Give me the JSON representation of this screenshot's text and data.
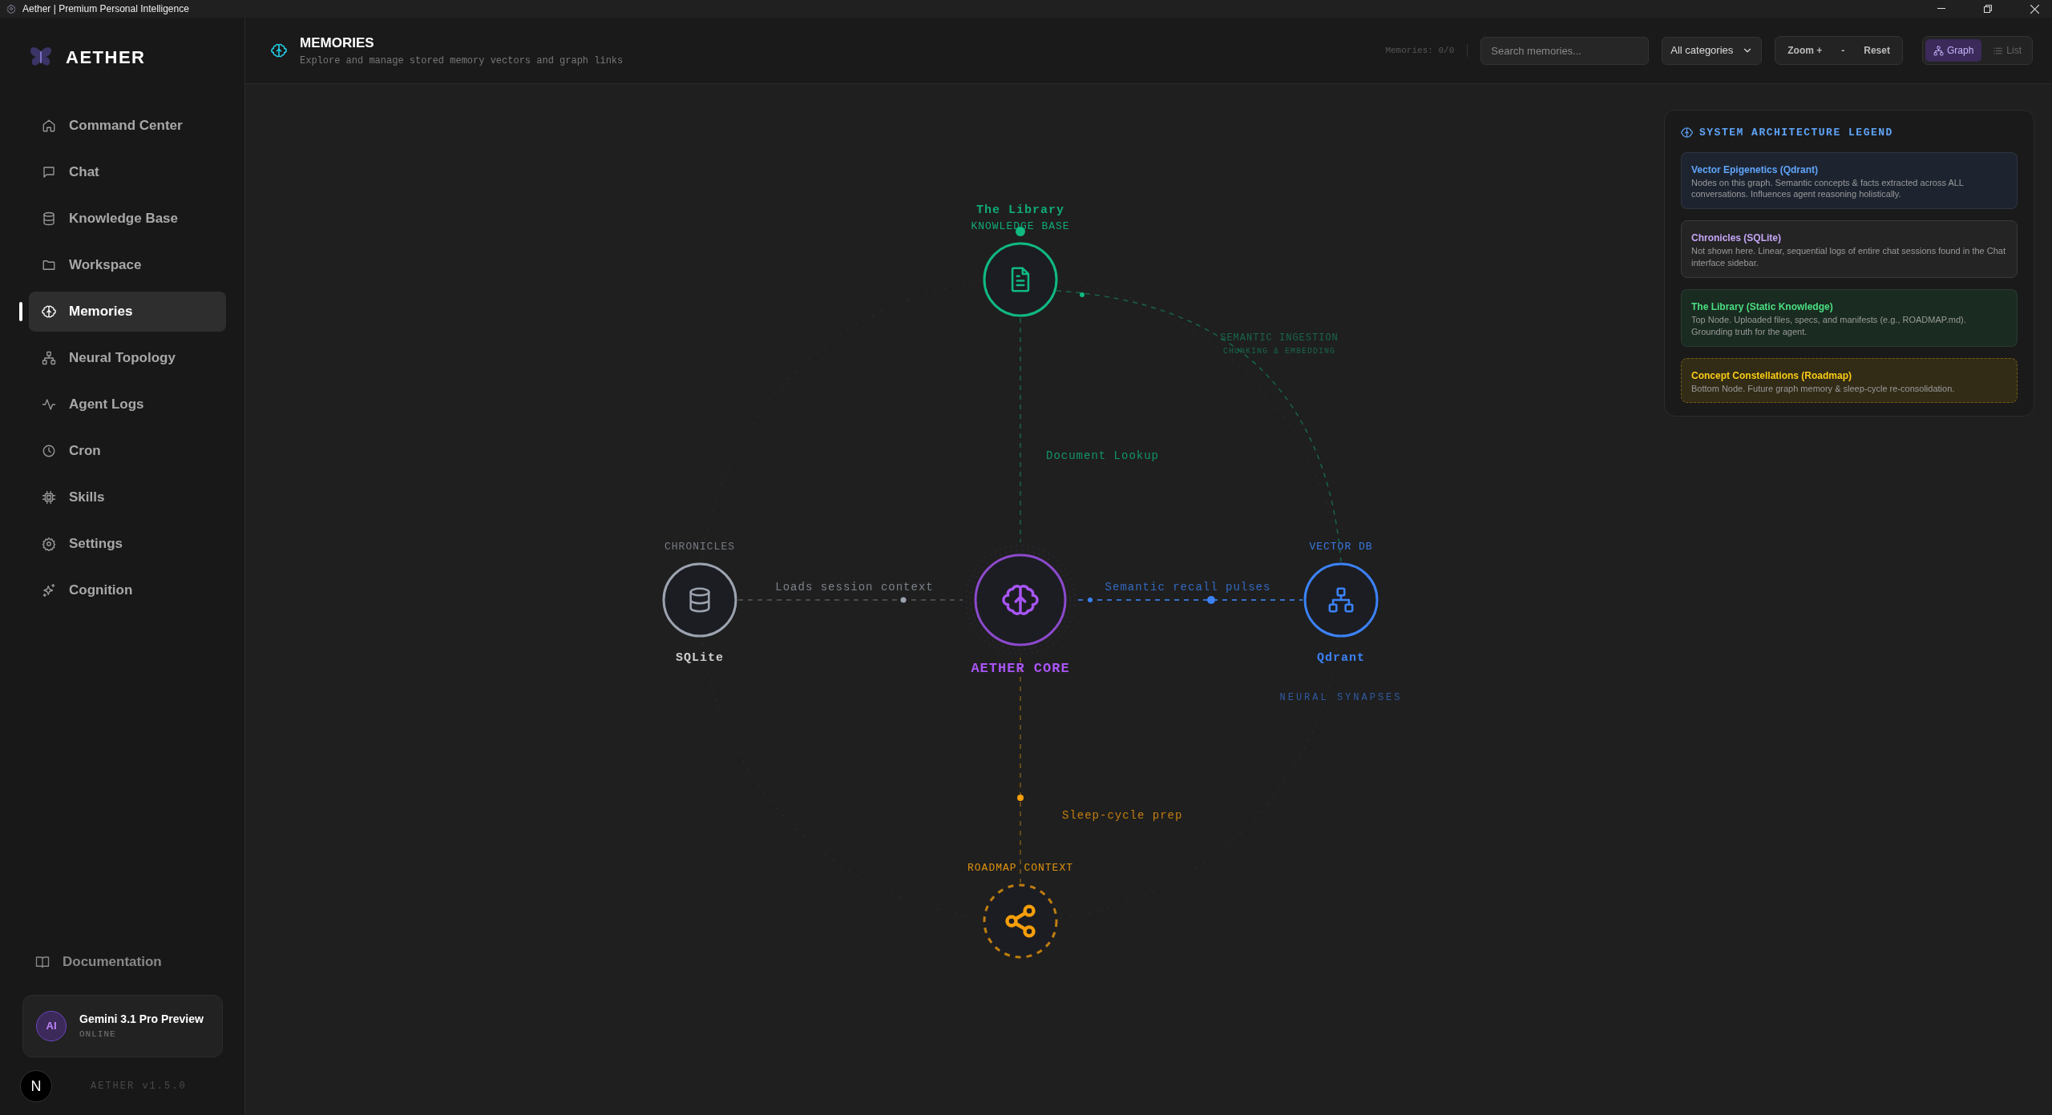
{
  "window": {
    "title": "Aether | Premium Personal Intelligence"
  },
  "sidebar": {
    "brand": "AETHER",
    "items": [
      {
        "label": "Command Center",
        "selected": false
      },
      {
        "label": "Chat",
        "selected": false
      },
      {
        "label": "Knowledge Base",
        "selected": false
      },
      {
        "label": "Workspace",
        "selected": false
      },
      {
        "label": "Memories",
        "selected": true
      },
      {
        "label": "Neural Topology",
        "selected": false
      },
      {
        "label": "Agent Logs",
        "selected": false
      },
      {
        "label": "Cron",
        "selected": false
      },
      {
        "label": "Skills",
        "selected": false
      },
      {
        "label": "Settings",
        "selected": false
      },
      {
        "label": "Cognition",
        "selected": false
      }
    ],
    "footer_link": "Documentation",
    "model": {
      "avatar": "AI",
      "name": "Gemini 3.1 Pro Preview",
      "status": "ONLINE"
    },
    "user_initial": "N",
    "version": "AETHER v1.5.0"
  },
  "header": {
    "title": "MEMORIES",
    "subtitle": "Explore and manage stored memory vectors and graph links",
    "count": "Memories: 0/0",
    "search": {
      "placeholder": "Search memories..."
    },
    "category": "All categories",
    "zoom_buttons": [
      "Zoom +",
      "-",
      "Reset"
    ],
    "views": [
      {
        "label": "Graph",
        "selected": true
      },
      {
        "label": "List",
        "selected": false
      }
    ]
  },
  "graph": {
    "nodes": [
      {
        "kind": "solid",
        "color": "#10b981",
        "above": [
          "The Library",
          "KNOWLEDGE BASE"
        ]
      },
      {
        "kind": "solid",
        "color": "#9ca3af",
        "above": [
          "CHRONICLES"
        ],
        "below": [
          "SQLite"
        ]
      },
      {
        "kind": "core",
        "color": "#a855f7",
        "below": [
          "AETHER CORE"
        ]
      },
      {
        "kind": "solid",
        "color": "#3b82f6",
        "above": [
          "VECTOR DB"
        ],
        "below": [
          "Qdrant",
          "NEURAL SYNAPSES"
        ]
      },
      {
        "kind": "dashed",
        "color": "#f59e0b",
        "above": [
          "ROADMAP CONTEXT"
        ]
      }
    ],
    "edges": [
      {
        "color": "#10b981",
        "labels": [
          "Document Lookup"
        ]
      },
      {
        "color": "#9ca3af",
        "labels": [
          "Loads session context"
        ]
      },
      {
        "color": "#3b82f6",
        "labels": [
          "Semantic recall pulses"
        ]
      },
      {
        "color": "#10b981",
        "labels": [
          "SEMANTIC INGESTION",
          "CHUNKING & EMBEDDING"
        ]
      },
      {
        "color": "#f59e0b",
        "labels": [
          "Sleep-cycle prep"
        ]
      }
    ]
  },
  "legend": {
    "title": "SYSTEM ARCHITECTURE LEGEND",
    "items": [
      {
        "kind": "solid",
        "color": "#60a5fa",
        "title": "Vector Epigenetics (Qdrant)",
        "text": "Nodes on this graph. Semantic concepts & facts extracted across ALL conversations. Influences agent reasoning holistically."
      },
      {
        "kind": "solid",
        "color": "#c4a5f5",
        "title": "Chronicles (SQLite)",
        "text": "Not shown here. Linear, sequential logs of entire chat sessions found in the Chat interface sidebar."
      },
      {
        "kind": "solid",
        "color": "#4ade80",
        "title": "The Library (Static Knowledge)",
        "text": "Top Node. Uploaded files, specs, and manifests (e.g., ROADMAP.md). Grounding truth for the agent."
      },
      {
        "kind": "dashed",
        "color": "#facc15",
        "title": "Concept Constellations (Roadmap)",
        "text": "Bottom Node. Future graph memory & sleep-cycle re-consolidation."
      }
    ]
  }
}
